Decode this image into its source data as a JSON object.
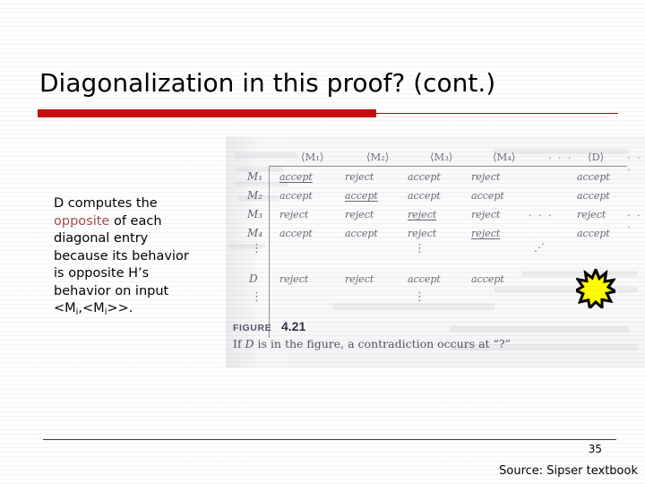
{
  "slide": {
    "title": "Diagonalization in this proof? (cont.)",
    "page_number": "35",
    "source_note": "Source: Sipser textbook",
    "accent_color": "#c90c0c",
    "rule_color": "#8a1418",
    "footer_rule_color": "#7e1b24",
    "highlight_color": "#a84a4a"
  },
  "body": {
    "line1": "D computes the",
    "highlight": "opposite",
    "line2_rest": " of each",
    "line3": "diagonal entry",
    "line4": "because its behavior",
    "line5": "is opposite H’s",
    "line6": "behavior on input",
    "line7_prefix": "<M",
    "line7_sub1": "i",
    "line7_mid": ",<M",
    "line7_sub2": "i",
    "line7_suffix": ">>."
  },
  "figure": {
    "caption_label": "FIGURE",
    "caption_number": "4.21",
    "caption_text_a": "If ",
    "caption_text_italic": "D",
    "caption_text_b": " is in the figure, a contradiction occurs at “?”",
    "column_headers": [
      "⟨M₁⟩",
      "⟨M₂⟩",
      "⟨M₃⟩",
      "⟨M₄⟩",
      "⟨D⟩"
    ],
    "header_ellipsis_mid": "· · ·",
    "header_ellipsis_end": "· · ·",
    "row_labels": [
      "M₁",
      "M₂",
      "M₃",
      "M₄",
      "D"
    ],
    "vertical_dots": "⋮",
    "diagonal_dots": "⋰",
    "rows": [
      {
        "label": "M₁",
        "cells": [
          "accept",
          "reject",
          "accept",
          "reject",
          "accept"
        ],
        "underlined_index": 0
      },
      {
        "label": "M₂",
        "cells": [
          "accept",
          "accept",
          "accept",
          "accept",
          "accept"
        ],
        "underlined_index": 1
      },
      {
        "label": "M₃",
        "cells": [
          "reject",
          "reject",
          "reject",
          "reject",
          "reject"
        ],
        "underlined_index": 2
      },
      {
        "label": "M₄",
        "cells": [
          "accept",
          "accept",
          "reject",
          "reject",
          "accept"
        ],
        "underlined_index": 3
      }
    ],
    "d_row": {
      "label": "D",
      "cells": [
        "reject",
        "reject",
        "accept",
        "accept"
      ],
      "contradiction_cell": "?"
    },
    "starburst_color": "#ffff00",
    "starburst_outline": "#000000"
  }
}
